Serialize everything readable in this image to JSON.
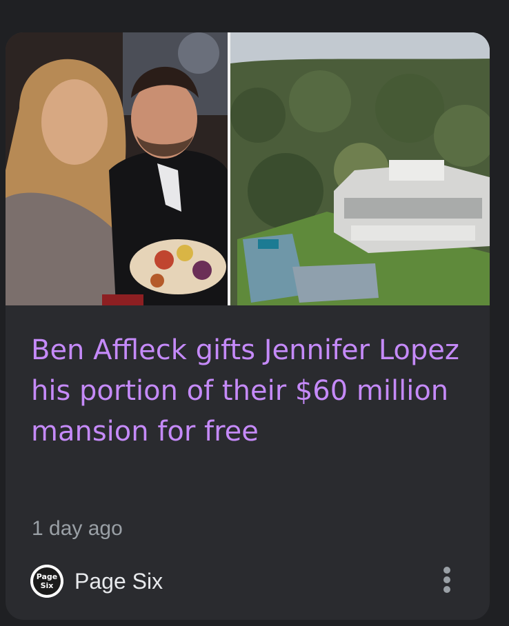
{
  "card": {
    "headline": "Ben Affleck gifts Jennifer Lopez his portion of their $60 million mansion for free",
    "time": "1 day ago",
    "source": {
      "name": "Page Six",
      "logo_text_top": "Page",
      "logo_text_bottom": "Six"
    }
  },
  "colors": {
    "headline": "#c58af9",
    "card_bg": "#2a2b2f",
    "page_bg": "#1f2023",
    "meta": "#9aa0a6"
  },
  "icons": {
    "more": "more-vert-icon"
  }
}
